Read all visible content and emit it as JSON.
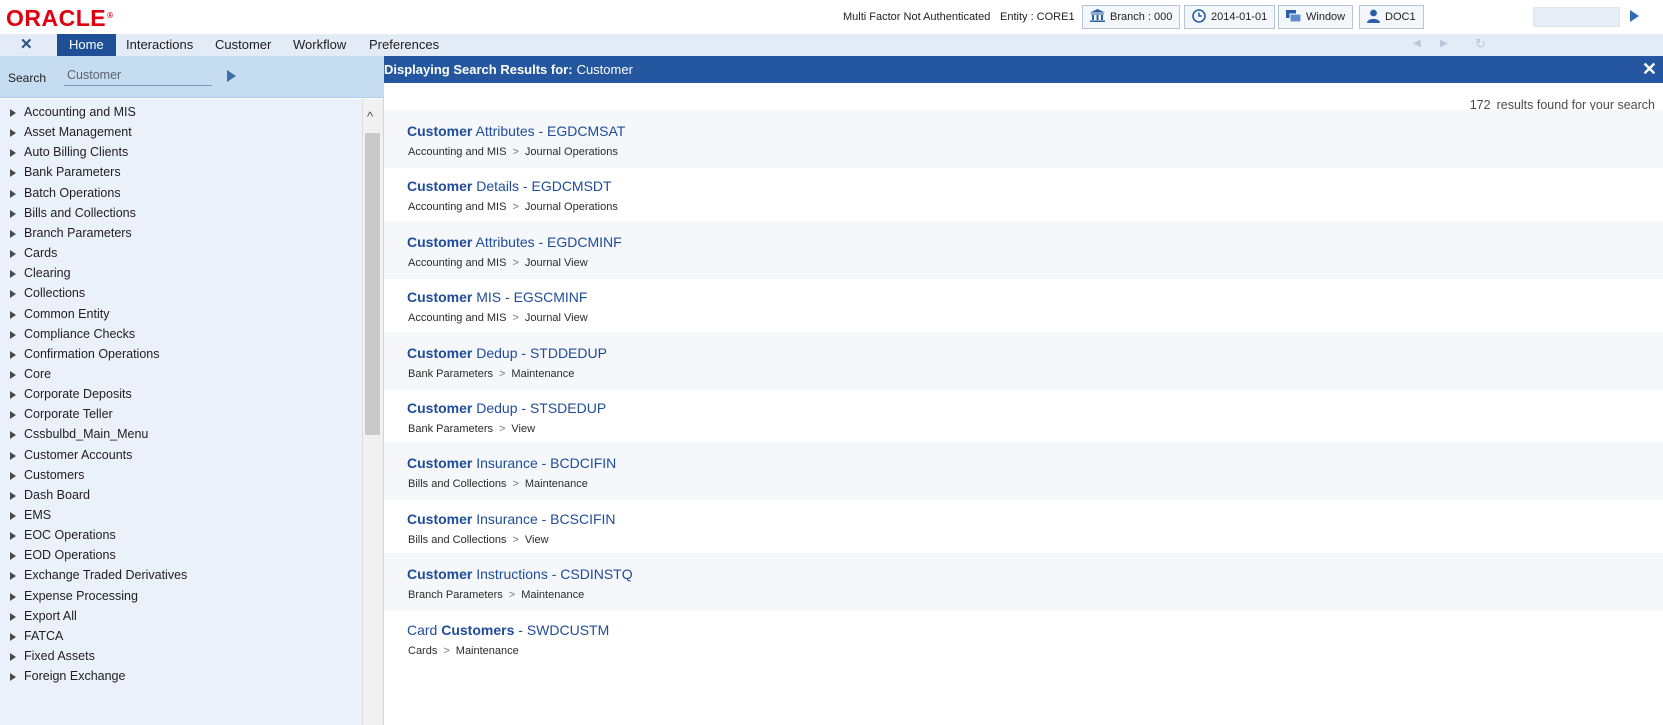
{
  "header": {
    "logo": "ORACLE",
    "logo_mark": "®",
    "auth_status": "Multi Factor Not Authenticated",
    "entity": "Entity : CORE1",
    "branch": "Branch : 000",
    "date": "2014-01-01",
    "window": "Window",
    "user": "DOC1"
  },
  "menu": {
    "close_glyph": "✕",
    "items": [
      "Home",
      "Interactions",
      "Customer",
      "Workflow",
      "Preferences"
    ],
    "active": "Home"
  },
  "search": {
    "label": "Search",
    "value": "Customer"
  },
  "tree": {
    "items": [
      "Accounting and MIS",
      "Asset Management",
      "Auto Billing Clients",
      "Bank Parameters",
      "Batch Operations",
      "Bills and Collections",
      "Branch Parameters",
      "Cards",
      "Clearing",
      "Collections",
      "Common Entity",
      "Compliance Checks",
      "Confirmation Operations",
      "Core",
      "Corporate Deposits",
      "Corporate Teller",
      "Cssbulbd_Main_Menu",
      "Customer Accounts",
      "Customers",
      "Dash Board",
      "EMS",
      "EOC Operations",
      "EOD Operations",
      "Exchange Traded Derivatives",
      "Expense Processing",
      "Export All",
      "FATCA",
      "Fixed Assets",
      "Foreign Exchange"
    ]
  },
  "results": {
    "header_label": "Displaying Search Results for:",
    "query": "Customer",
    "count": "172",
    "count_text": "results found for your search",
    "separator": ">",
    "items": [
      {
        "lead": "",
        "bold": "Customer",
        "rest": " Attributes - EGDCMSAT",
        "path": [
          "Accounting and MIS",
          "Journal Operations"
        ]
      },
      {
        "lead": "",
        "bold": "Customer",
        "rest": " Details - EGDCMSDT",
        "path": [
          "Accounting and MIS",
          "Journal Operations"
        ]
      },
      {
        "lead": "",
        "bold": "Customer",
        "rest": " Attributes - EGDCMINF",
        "path": [
          "Accounting and MIS",
          "Journal View"
        ]
      },
      {
        "lead": "",
        "bold": "Customer",
        "rest": " MIS - EGSCMINF",
        "path": [
          "Accounting and MIS",
          "Journal View"
        ]
      },
      {
        "lead": "",
        "bold": "Customer",
        "rest": " Dedup - STDDEDUP",
        "path": [
          "Bank Parameters",
          "Maintenance"
        ]
      },
      {
        "lead": "",
        "bold": "Customer",
        "rest": " Dedup - STSDEDUP",
        "path": [
          "Bank Parameters",
          "View"
        ]
      },
      {
        "lead": "",
        "bold": "Customer",
        "rest": " Insurance - BCDCIFIN",
        "path": [
          "Bills and Collections",
          "Maintenance"
        ]
      },
      {
        "lead": "",
        "bold": "Customer",
        "rest": " Insurance - BCSCIFIN",
        "path": [
          "Bills and Collections",
          "View"
        ]
      },
      {
        "lead": "",
        "bold": "Customer",
        "rest": " Instructions - CSDINSTQ",
        "path": [
          "Branch Parameters",
          "Maintenance"
        ]
      },
      {
        "lead": "Card ",
        "bold": "Customers",
        "rest": " - SWDCUSTM",
        "path": [
          "Cards",
          "Maintenance"
        ]
      }
    ]
  },
  "colors": {
    "brand_red": "#e0000f",
    "header_blue": "#24579f",
    "active_tab": "#1f4f95",
    "link_blue": "#1e4c9a",
    "pane_bg": "#eaf1fa",
    "search_bg": "#c6dcf1"
  }
}
